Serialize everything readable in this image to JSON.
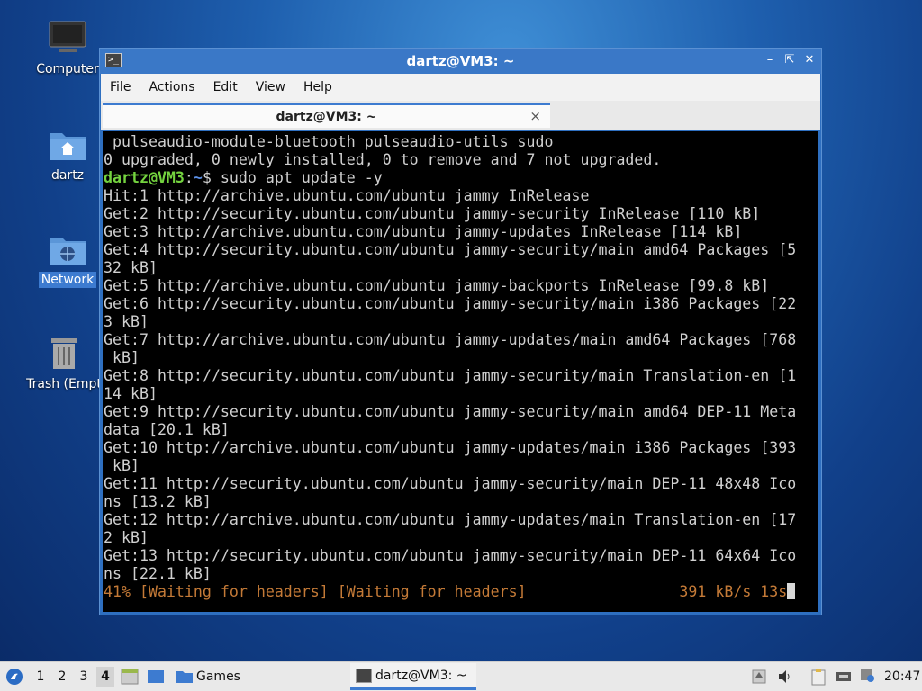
{
  "desktop": {
    "icons": [
      {
        "label": "Computer"
      },
      {
        "label": "dartz"
      },
      {
        "label": "Network"
      },
      {
        "label": "Trash (Empt"
      }
    ]
  },
  "window": {
    "title": "dartz@VM3: ~",
    "menu": [
      "File",
      "Actions",
      "Edit",
      "View",
      "Help"
    ],
    "tab_label": "dartz@VM3: ~",
    "tab_close": "×"
  },
  "terminal": {
    "lines": [
      " pulseaudio-module-bluetooth pulseaudio-utils sudo",
      "0 upgraded, 0 newly installed, 0 to remove and 7 not upgraded.",
      "Hit:1 http://archive.ubuntu.com/ubuntu jammy InRelease",
      "Get:2 http://security.ubuntu.com/ubuntu jammy-security InRelease [110 kB]",
      "Get:3 http://archive.ubuntu.com/ubuntu jammy-updates InRelease [114 kB]",
      "Get:4 http://security.ubuntu.com/ubuntu jammy-security/main amd64 Packages [5",
      "32 kB]",
      "Get:5 http://archive.ubuntu.com/ubuntu jammy-backports InRelease [99.8 kB]",
      "Get:6 http://security.ubuntu.com/ubuntu jammy-security/main i386 Packages [22",
      "3 kB]",
      "Get:7 http://archive.ubuntu.com/ubuntu jammy-updates/main amd64 Packages [768",
      " kB]",
      "Get:8 http://security.ubuntu.com/ubuntu jammy-security/main Translation-en [1",
      "14 kB]",
      "Get:9 http://security.ubuntu.com/ubuntu jammy-security/main amd64 DEP-11 Meta",
      "data [20.1 kB]",
      "Get:10 http://archive.ubuntu.com/ubuntu jammy-updates/main i386 Packages [393",
      " kB]",
      "Get:11 http://security.ubuntu.com/ubuntu jammy-security/main DEP-11 48x48 Ico",
      "ns [13.2 kB]",
      "Get:12 http://archive.ubuntu.com/ubuntu jammy-updates/main Translation-en [17",
      "2 kB]",
      "Get:13 http://security.ubuntu.com/ubuntu jammy-security/main DEP-11 64x64 Ico",
      "ns [22.1 kB]"
    ],
    "prompt_user": "dartz@VM3",
    "prompt_sep": ":",
    "prompt_path": "~",
    "prompt_symbol": "$ ",
    "command": "sudo apt update -y",
    "progress_text": "41% [Waiting for headers] [Waiting for headers]",
    "progress_pad": "                 ",
    "speed_text": "391 kB/s 13s"
  },
  "taskbar": {
    "workspaces": [
      "1",
      "2",
      "3",
      "4"
    ],
    "active_workspace": "4",
    "games_label": "Games",
    "task_label": "dartz@VM3: ~",
    "clock": "20:47"
  },
  "colors": {
    "accent": "#3d7bd0",
    "prompt_user": "#74d33f",
    "prompt_path": "#5b8fe5",
    "progress": "#c47a37"
  },
  "icons": [
    "computer-icon",
    "home-folder-icon",
    "network-folder-icon",
    "trash-icon",
    "terminal-icon",
    "start-menu-icon",
    "file-manager-icon",
    "folder-icon",
    "volume-icon",
    "clipboard-icon",
    "network-status-icon",
    "update-notifier-icon"
  ]
}
